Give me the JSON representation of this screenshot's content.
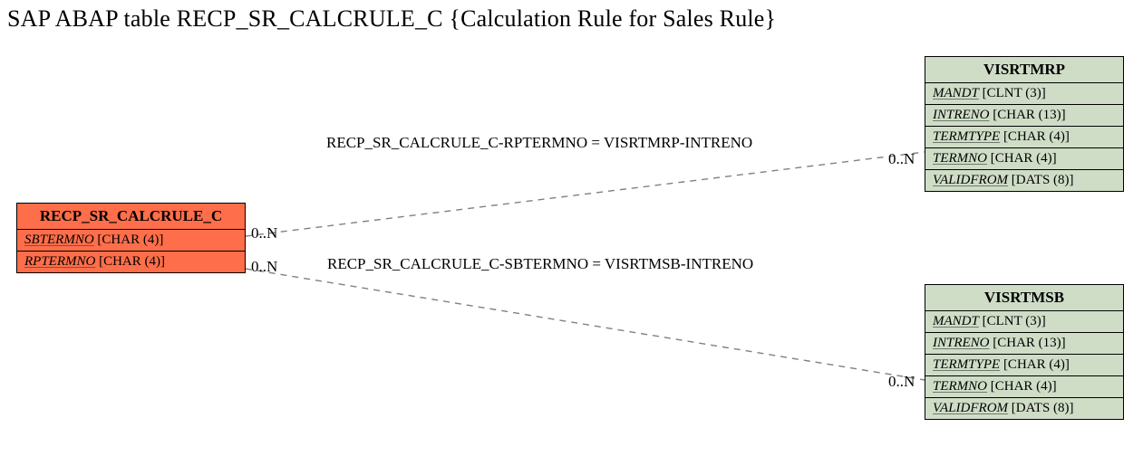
{
  "title": "SAP ABAP table RECP_SR_CALCRULE_C {Calculation Rule for Sales Rule}",
  "mainEntity": {
    "name": "RECP_SR_CALCRULE_C",
    "fields": [
      {
        "name": "SBTERMNO",
        "type": "[CHAR (4)]"
      },
      {
        "name": "RPTERMNO",
        "type": "[CHAR (4)]"
      }
    ]
  },
  "refEntities": {
    "visrtmrp": {
      "name": "VISRTMRP",
      "fields": [
        {
          "name": "MANDT",
          "type": "[CLNT (3)]"
        },
        {
          "name": "INTRENO",
          "type": "[CHAR (13)]"
        },
        {
          "name": "TERMTYPE",
          "type": "[CHAR (4)]"
        },
        {
          "name": "TERMNO",
          "type": "[CHAR (4)]"
        },
        {
          "name": "VALIDFROM",
          "type": "[DATS (8)]"
        }
      ]
    },
    "visrtmsb": {
      "name": "VISRTMSB",
      "fields": [
        {
          "name": "MANDT",
          "type": "[CLNT (3)]"
        },
        {
          "name": "INTRENO",
          "type": "[CHAR (13)]"
        },
        {
          "name": "TERMTYPE",
          "type": "[CHAR (4)]"
        },
        {
          "name": "TERMNO",
          "type": "[CHAR (4)]"
        },
        {
          "name": "VALIDFROM",
          "type": "[DATS (8)]"
        }
      ]
    }
  },
  "relations": {
    "r1": {
      "label": "RECP_SR_CALCRULE_C-RPTERMNO = VISRTMRP-INTRENO",
      "leftCard": "0..N",
      "rightCard": "0..N"
    },
    "r2": {
      "label": "RECP_SR_CALCRULE_C-SBTERMNO = VISRTMSB-INTRENO",
      "leftCard": "0..N",
      "rightCard": "0..N"
    }
  }
}
